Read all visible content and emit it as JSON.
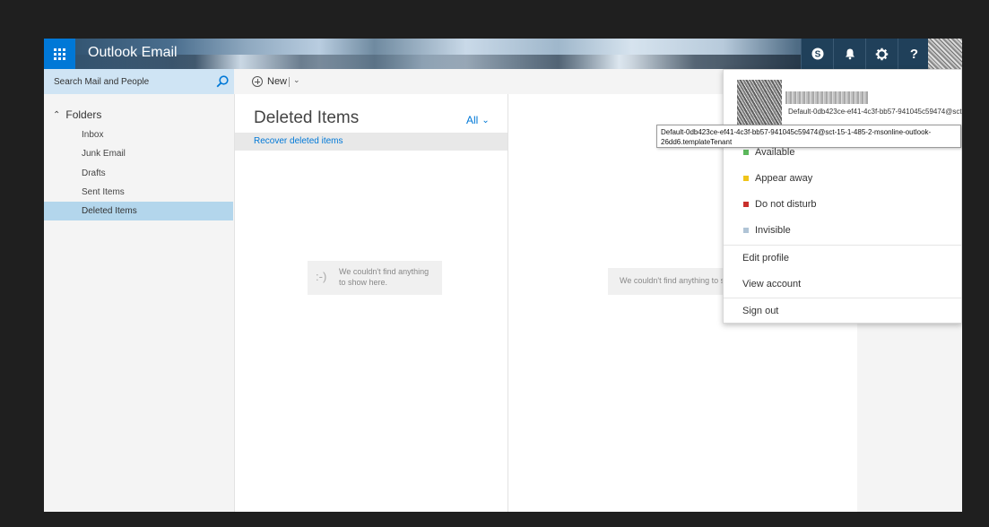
{
  "header": {
    "app_title": "Outlook Email",
    "icons": [
      "waffle-icon",
      "skype-icon",
      "bell-icon",
      "gear-icon",
      "help-icon"
    ],
    "help_label": "?"
  },
  "search": {
    "placeholder": "Search Mail and People"
  },
  "commands": {
    "new_label": "New"
  },
  "folders": {
    "title": "Folders",
    "items": [
      "Inbox",
      "Junk Email",
      "Drafts",
      "Sent Items",
      "Deleted Items"
    ],
    "selected": "Deleted Items"
  },
  "message_list": {
    "title": "Deleted Items",
    "filter_label": "All",
    "recover_link": "Recover deleted items",
    "empty_face": ":-)",
    "empty_text": "We couldn't find anything to show here."
  },
  "reading_pane": {
    "empty_text": "We couldn't find anything to show here."
  },
  "profile_menu": {
    "email": "Default-0db423ce-ef41-4c3f-bb57-941045c59474@sct-15-1-485-2-msonline-outlook-26dd6.templateTenant",
    "statuses": [
      {
        "label": "Available",
        "color": "#5cb85c"
      },
      {
        "label": "Appear away",
        "color": "#f0c419"
      },
      {
        "label": "Do not disturb",
        "color": "#c9302c"
      },
      {
        "label": "Invisible",
        "color": "#b0c4d6"
      }
    ],
    "edit_profile": "Edit profile",
    "view_account": "View account",
    "sign_out": "Sign out"
  },
  "tooltip": {
    "text": "Default-0db423ce-ef41-4c3f-bb57-941045c59474@sct-15-1-485-2-msonline-outlook-26dd6.templateTenant"
  },
  "colors": {
    "accent": "#0078d7",
    "selected_folder": "#b3d6ec",
    "search_bg": "#cfe4f4"
  }
}
